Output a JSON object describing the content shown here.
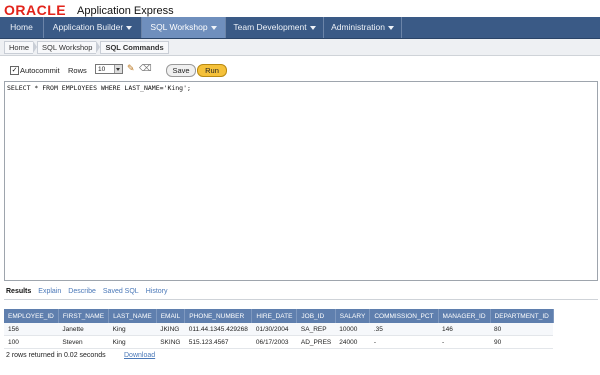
{
  "header": {
    "logo": "ORACLE",
    "app_title": "Application Express"
  },
  "nav": {
    "tabs": [
      {
        "label": "Home",
        "has_menu": false,
        "active": false
      },
      {
        "label": "Application Builder",
        "has_menu": true,
        "active": false
      },
      {
        "label": "SQL Workshop",
        "has_menu": true,
        "active": true
      },
      {
        "label": "Team Development",
        "has_menu": true,
        "active": false
      },
      {
        "label": "Administration",
        "has_menu": true,
        "active": false
      }
    ]
  },
  "breadcrumb": {
    "items": [
      "Home",
      "SQL Workshop",
      "SQL Commands"
    ]
  },
  "toolbar": {
    "autocommit_label": "Autocommit",
    "autocommit_checked": true,
    "rows_label": "Rows",
    "rows_value": "10",
    "save_label": "Save",
    "run_label": "Run"
  },
  "editor": {
    "sql": "SELECT * FROM EMPLOYEES WHERE LAST_NAME='King';"
  },
  "result_tabs": [
    {
      "label": "Results",
      "active": true
    },
    {
      "label": "Explain",
      "active": false
    },
    {
      "label": "Describe",
      "active": false
    },
    {
      "label": "Saved SQL",
      "active": false
    },
    {
      "label": "History",
      "active": false
    }
  ],
  "table": {
    "columns": [
      "EMPLOYEE_ID",
      "FIRST_NAME",
      "LAST_NAME",
      "EMAIL",
      "PHONE_NUMBER",
      "HIRE_DATE",
      "JOB_ID",
      "SALARY",
      "COMMISSION_PCT",
      "MANAGER_ID",
      "DEPARTMENT_ID"
    ],
    "rows": [
      [
        "156",
        "Janette",
        "King",
        "JKING",
        "011.44.1345.429268",
        "01/30/2004",
        "SA_REP",
        "10000",
        ".35",
        "146",
        "80"
      ],
      [
        "100",
        "Steven",
        "King",
        "SKING",
        "515.123.4567",
        "06/17/2003",
        "AD_PRES",
        "24000",
        "-",
        "-",
        "90"
      ]
    ]
  },
  "footer": {
    "status": "2 rows returned in 0.02 seconds",
    "download_label": "Download"
  },
  "colors": {
    "nav_bg": "#3a5a86",
    "nav_active": "#6f8fbd",
    "run_button": "#f5c13a",
    "logo_red": "#e2231a",
    "table_header": "#5f7fae"
  }
}
